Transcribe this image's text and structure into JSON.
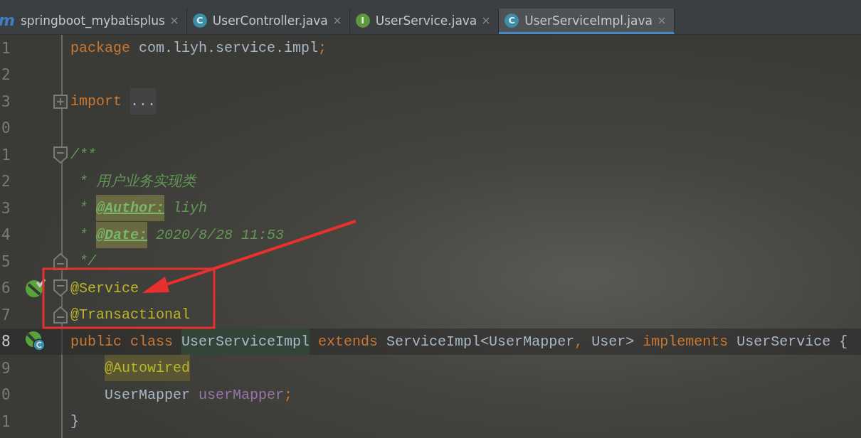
{
  "tabs": [
    {
      "kind": "maven",
      "icon_letter": "m",
      "label": "springboot_mybatisplus",
      "selected": false
    },
    {
      "kind": "class",
      "icon_letter": "C",
      "label": "UserController.java",
      "selected": false
    },
    {
      "kind": "interface",
      "icon_letter": "I",
      "label": "UserService.java",
      "selected": false
    },
    {
      "kind": "class",
      "icon_letter": "C",
      "label": "UserServiceImpl.java",
      "selected": true
    }
  ],
  "lines": [
    {
      "number": "1",
      "current": false,
      "tokens": [
        {
          "text": "package ",
          "kind": "keyword"
        },
        {
          "text": "com.liyh.service.impl",
          "kind": "plain"
        },
        {
          "text": ";",
          "kind": "keyword"
        }
      ]
    },
    {
      "number": "2",
      "current": false
    },
    {
      "number": "3",
      "current": false,
      "fold": {
        "kind": "expand"
      },
      "tokens": [
        {
          "text": "import ",
          "kind": "keyword"
        },
        {
          "text": "...",
          "kind": "folded-text",
          "highlighted": true
        }
      ]
    },
    {
      "number": "0",
      "current": false
    },
    {
      "number": "1",
      "current": false,
      "fold": {
        "kind": "start"
      },
      "tokens": [
        {
          "text": "/**",
          "kind": "comment"
        }
      ]
    },
    {
      "number": "2",
      "current": false,
      "tokens": [
        {
          "text": " * 用户业务实现类",
          "kind": "comment"
        }
      ]
    },
    {
      "number": "3",
      "current": false,
      "tokens": [
        {
          "text": " * ",
          "kind": "comment"
        },
        {
          "text": "@Author:",
          "kind": "doc-tag",
          "highlighted": true
        },
        {
          "text": " liyh",
          "kind": "comment"
        }
      ]
    },
    {
      "number": "4",
      "current": false,
      "tokens": [
        {
          "text": " * ",
          "kind": "comment"
        },
        {
          "text": "@Date:",
          "kind": "doc-tag",
          "highlighted": true
        },
        {
          "text": " 2020/8/28 11:53",
          "kind": "comment"
        }
      ]
    },
    {
      "number": "5",
      "current": false,
      "fold": {
        "kind": "end"
      },
      "tokens": [
        {
          "text": " */",
          "kind": "comment"
        }
      ]
    },
    {
      "number": "6",
      "current": false,
      "gutter_icon": {
        "kind": "bean"
      },
      "fold": {
        "kind": "start"
      },
      "tokens": [
        {
          "text": "@Service",
          "kind": "annotation"
        }
      ]
    },
    {
      "number": "7",
      "current": false,
      "fold": {
        "kind": "end"
      },
      "tokens": [
        {
          "text": "@Transactional",
          "kind": "annotation"
        }
      ]
    },
    {
      "number": "8",
      "current": true,
      "gutter_icon": {
        "kind": "class"
      },
      "tokens": [
        {
          "text": "public class ",
          "kind": "keyword"
        },
        {
          "text": "UserServiceImpl",
          "kind": "plain",
          "highlighted": true
        },
        {
          "text": " extends ",
          "kind": "keyword"
        },
        {
          "text": "ServiceImpl<UserMapper",
          "kind": "plain"
        },
        {
          "text": ",",
          "kind": "keyword"
        },
        {
          "text": " User> ",
          "kind": "plain"
        },
        {
          "text": "implements ",
          "kind": "keyword"
        },
        {
          "text": "UserService {",
          "kind": "plain"
        }
      ]
    },
    {
      "number": "9",
      "current": false,
      "indent": true,
      "tokens": [
        {
          "text": "@Autowired",
          "kind": "annotation",
          "highlighted": true
        }
      ]
    },
    {
      "number": "0",
      "current": false,
      "indent": true,
      "tokens": [
        {
          "text": "UserMapper ",
          "kind": "plain"
        },
        {
          "text": "userMapper",
          "kind": "field"
        },
        {
          "text": ";",
          "kind": "keyword"
        }
      ]
    },
    {
      "number": "1",
      "current": false,
      "tokens": [
        {
          "text": "}",
          "kind": "plain"
        }
      ]
    }
  ]
}
